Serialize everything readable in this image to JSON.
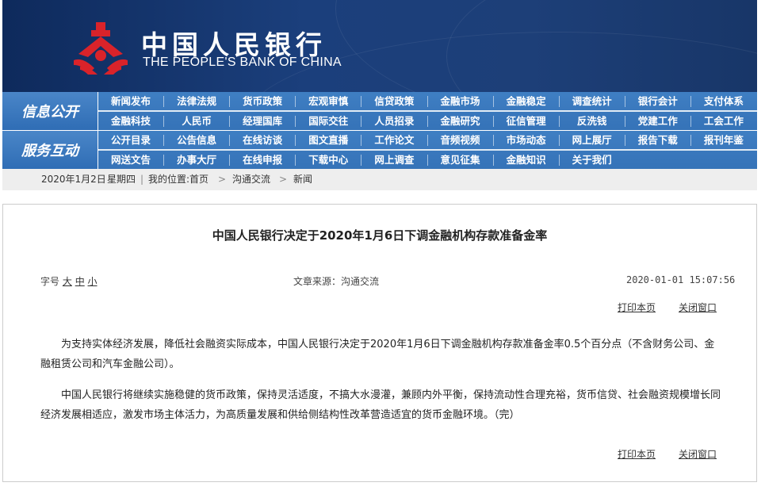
{
  "header": {
    "bank_name_cn": "中国人民银行",
    "bank_name_en": "THE PEOPLE'S BANK OF CHINA",
    "logo_icon": "pboc-emblem-icon",
    "colors": {
      "banner": "#1b3f7c",
      "nav": "#3a78bd",
      "logo_red": "#d9232a"
    }
  },
  "nav": {
    "group1_title": "信息公开",
    "group1_row1": [
      "新闻发布",
      "法律法规",
      "货币政策",
      "宏观审慎",
      "信贷政策",
      "金融市场",
      "金融稳定",
      "调查统计",
      "银行会计",
      "支付体系"
    ],
    "group1_row2": [
      "金融科技",
      "人民币",
      "经理国库",
      "国际交往",
      "人员招录",
      "金融研究",
      "征信管理",
      "反洗钱",
      "党建工作",
      "工会工作"
    ],
    "group2_title": "服务互动",
    "group2_row1": [
      "公开目录",
      "公告信息",
      "在线访谈",
      "图文直播",
      "工作论文",
      "音频视频",
      "市场动态",
      "网上展厅",
      "报告下载",
      "报刊年鉴"
    ],
    "group2_row2": [
      "网送文告",
      "办事大厅",
      "在线申报",
      "下载中心",
      "网上调查",
      "意见征集",
      "金融知识",
      "关于我们"
    ]
  },
  "breadcrumb": {
    "date": "2020年1月2日",
    "weekday": "星期四",
    "location_label": "我的位置:",
    "home": "首页",
    "sep": ">",
    "level1": "沟通交流",
    "level2": "新闻"
  },
  "article": {
    "title": "中国人民银行决定于2020年1月6日下调金融机构存款准备金率",
    "font_label": "字号",
    "font_large": "大",
    "font_medium": "中",
    "font_small": "小",
    "source": "文章来源：沟通交流",
    "datetime": "2020-01-01 15:07:56",
    "print": "打印本页",
    "close": "关闭窗口",
    "para1": "为支持实体经济发展，降低社会融资实际成本，中国人民银行决定于2020年1月6日下调金融机构存款准备金率0.5个百分点（不含财务公司、金融租赁公司和汽车金融公司）。",
    "para2": "中国人民银行将继续实施稳健的货币政策，保持灵活适度，不搞大水漫灌，兼顾内外平衡，保持流动性合理充裕，货币信贷、社会融资规模增长同经济发展相适应，激发市场主体活力，为高质量发展和供给侧结构性改革营造适宜的货币金融环境。（完）"
  }
}
